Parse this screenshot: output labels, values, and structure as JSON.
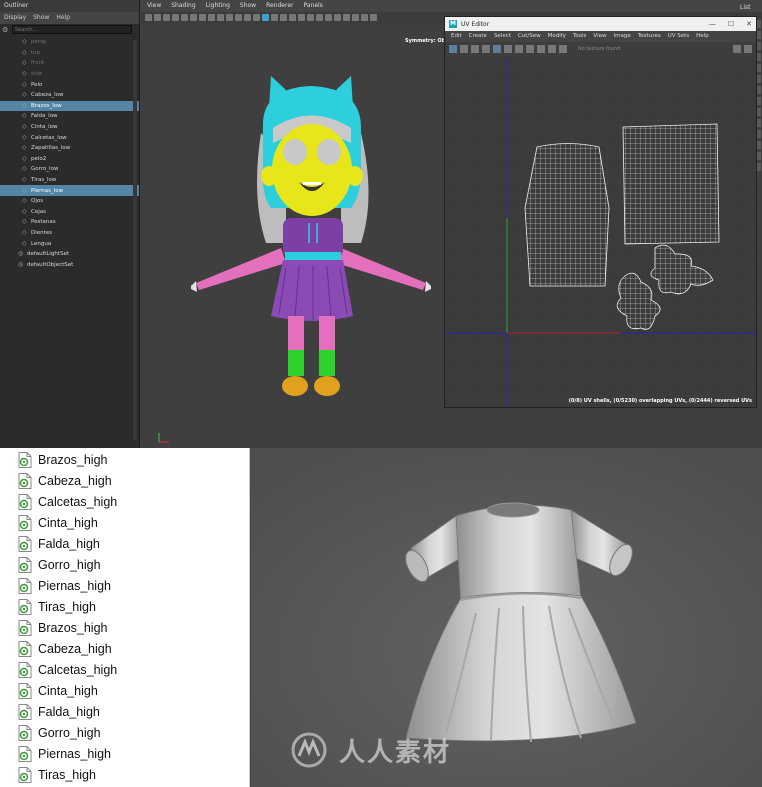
{
  "outliner": {
    "title": "Outliner",
    "menu": [
      "Display",
      "Show",
      "Help"
    ],
    "search_placeholder": "Search...",
    "items": [
      {
        "label": "persp",
        "state": "dim"
      },
      {
        "label": "top",
        "state": "dim"
      },
      {
        "label": "front",
        "state": "dim"
      },
      {
        "label": "side",
        "state": "dim"
      },
      {
        "label": "Pelo",
        "state": ""
      },
      {
        "label": "Cabeza_low",
        "state": ""
      },
      {
        "label": "Brazos_low",
        "state": "sel"
      },
      {
        "label": "Falda_low",
        "state": ""
      },
      {
        "label": "Cinta_low",
        "state": ""
      },
      {
        "label": "Calcetas_low",
        "state": ""
      },
      {
        "label": "Zapatillas_low",
        "state": ""
      },
      {
        "label": "pelo2",
        "state": ""
      },
      {
        "label": "Gorro_low",
        "state": ""
      },
      {
        "label": "Tiras_low",
        "state": ""
      },
      {
        "label": "Piernas_low",
        "state": "sel"
      },
      {
        "label": "Ojos",
        "state": ""
      },
      {
        "label": "Cejas",
        "state": ""
      },
      {
        "label": "Pestanas",
        "state": ""
      },
      {
        "label": "Dientes",
        "state": ""
      },
      {
        "label": "Lengua",
        "state": ""
      },
      {
        "label": "defaultLightSet",
        "state": "set"
      },
      {
        "label": "defaultObjectSet",
        "state": "set"
      }
    ]
  },
  "viewport": {
    "menu": [
      "View",
      "Shading",
      "Lighting",
      "Show",
      "Renderer",
      "Panels"
    ],
    "symmetry_label": "Symmetry: Obj"
  },
  "uv_editor": {
    "title": "UV Editor",
    "logo": "M",
    "window_controls": [
      "—",
      "☐",
      "✕"
    ],
    "menu": [
      "Edit",
      "Create",
      "Select",
      "Cut/Sew",
      "Modify",
      "Tools",
      "View",
      "Image",
      "Textures",
      "UV Sets",
      "Help"
    ],
    "texture_status": "No texture found",
    "status": "(0/8) UV shells, (0/5230) overlapping UVs, (0/2444) reversed UVs"
  },
  "side_panel": {
    "label": "List"
  },
  "file_list": {
    "items": [
      "Brazos_high",
      "Cabeza_high",
      "Calcetas_high",
      "Cinta_high",
      "Falda_high",
      "Gorro_high",
      "Piernas_high",
      "Tiras_high",
      "Brazos_high",
      "Cabeza_high",
      "Calcetas_high",
      "Cinta_high",
      "Falda_high",
      "Gorro_high",
      "Piernas_high",
      "Tiras_high"
    ]
  },
  "watermark": {
    "text": "人人素材"
  },
  "colors": {
    "selection": "#5285a6",
    "hood": "#2ecfdc",
    "skin": "#e6e61a",
    "dress": "#7d3fa6",
    "socks": "#2fd12f",
    "uv_green_axis": "#21a821",
    "uv_red_axis": "#b02424",
    "uv_blue_axis": "#2424b0"
  }
}
